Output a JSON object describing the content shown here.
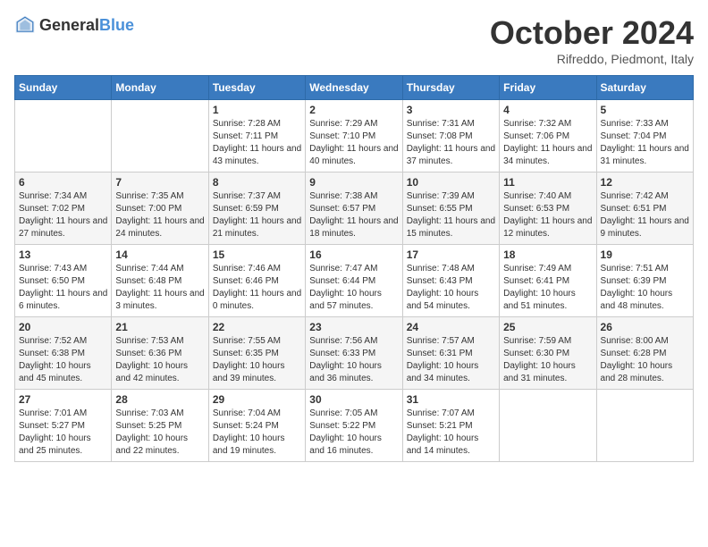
{
  "header": {
    "logo_general": "General",
    "logo_blue": "Blue",
    "title": "October 2024",
    "location": "Rifreddo, Piedmont, Italy"
  },
  "weekdays": [
    "Sunday",
    "Monday",
    "Tuesday",
    "Wednesday",
    "Thursday",
    "Friday",
    "Saturday"
  ],
  "weeks": [
    [
      {
        "day": "",
        "info": ""
      },
      {
        "day": "",
        "info": ""
      },
      {
        "day": "1",
        "info": "Sunrise: 7:28 AM\nSunset: 7:11 PM\nDaylight: 11 hours and 43 minutes."
      },
      {
        "day": "2",
        "info": "Sunrise: 7:29 AM\nSunset: 7:10 PM\nDaylight: 11 hours and 40 minutes."
      },
      {
        "day": "3",
        "info": "Sunrise: 7:31 AM\nSunset: 7:08 PM\nDaylight: 11 hours and 37 minutes."
      },
      {
        "day": "4",
        "info": "Sunrise: 7:32 AM\nSunset: 7:06 PM\nDaylight: 11 hours and 34 minutes."
      },
      {
        "day": "5",
        "info": "Sunrise: 7:33 AM\nSunset: 7:04 PM\nDaylight: 11 hours and 31 minutes."
      }
    ],
    [
      {
        "day": "6",
        "info": "Sunrise: 7:34 AM\nSunset: 7:02 PM\nDaylight: 11 hours and 27 minutes."
      },
      {
        "day": "7",
        "info": "Sunrise: 7:35 AM\nSunset: 7:00 PM\nDaylight: 11 hours and 24 minutes."
      },
      {
        "day": "8",
        "info": "Sunrise: 7:37 AM\nSunset: 6:59 PM\nDaylight: 11 hours and 21 minutes."
      },
      {
        "day": "9",
        "info": "Sunrise: 7:38 AM\nSunset: 6:57 PM\nDaylight: 11 hours and 18 minutes."
      },
      {
        "day": "10",
        "info": "Sunrise: 7:39 AM\nSunset: 6:55 PM\nDaylight: 11 hours and 15 minutes."
      },
      {
        "day": "11",
        "info": "Sunrise: 7:40 AM\nSunset: 6:53 PM\nDaylight: 11 hours and 12 minutes."
      },
      {
        "day": "12",
        "info": "Sunrise: 7:42 AM\nSunset: 6:51 PM\nDaylight: 11 hours and 9 minutes."
      }
    ],
    [
      {
        "day": "13",
        "info": "Sunrise: 7:43 AM\nSunset: 6:50 PM\nDaylight: 11 hours and 6 minutes."
      },
      {
        "day": "14",
        "info": "Sunrise: 7:44 AM\nSunset: 6:48 PM\nDaylight: 11 hours and 3 minutes."
      },
      {
        "day": "15",
        "info": "Sunrise: 7:46 AM\nSunset: 6:46 PM\nDaylight: 11 hours and 0 minutes."
      },
      {
        "day": "16",
        "info": "Sunrise: 7:47 AM\nSunset: 6:44 PM\nDaylight: 10 hours and 57 minutes."
      },
      {
        "day": "17",
        "info": "Sunrise: 7:48 AM\nSunset: 6:43 PM\nDaylight: 10 hours and 54 minutes."
      },
      {
        "day": "18",
        "info": "Sunrise: 7:49 AM\nSunset: 6:41 PM\nDaylight: 10 hours and 51 minutes."
      },
      {
        "day": "19",
        "info": "Sunrise: 7:51 AM\nSunset: 6:39 PM\nDaylight: 10 hours and 48 minutes."
      }
    ],
    [
      {
        "day": "20",
        "info": "Sunrise: 7:52 AM\nSunset: 6:38 PM\nDaylight: 10 hours and 45 minutes."
      },
      {
        "day": "21",
        "info": "Sunrise: 7:53 AM\nSunset: 6:36 PM\nDaylight: 10 hours and 42 minutes."
      },
      {
        "day": "22",
        "info": "Sunrise: 7:55 AM\nSunset: 6:35 PM\nDaylight: 10 hours and 39 minutes."
      },
      {
        "day": "23",
        "info": "Sunrise: 7:56 AM\nSunset: 6:33 PM\nDaylight: 10 hours and 36 minutes."
      },
      {
        "day": "24",
        "info": "Sunrise: 7:57 AM\nSunset: 6:31 PM\nDaylight: 10 hours and 34 minutes."
      },
      {
        "day": "25",
        "info": "Sunrise: 7:59 AM\nSunset: 6:30 PM\nDaylight: 10 hours and 31 minutes."
      },
      {
        "day": "26",
        "info": "Sunrise: 8:00 AM\nSunset: 6:28 PM\nDaylight: 10 hours and 28 minutes."
      }
    ],
    [
      {
        "day": "27",
        "info": "Sunrise: 7:01 AM\nSunset: 5:27 PM\nDaylight: 10 hours and 25 minutes."
      },
      {
        "day": "28",
        "info": "Sunrise: 7:03 AM\nSunset: 5:25 PM\nDaylight: 10 hours and 22 minutes."
      },
      {
        "day": "29",
        "info": "Sunrise: 7:04 AM\nSunset: 5:24 PM\nDaylight: 10 hours and 19 minutes."
      },
      {
        "day": "30",
        "info": "Sunrise: 7:05 AM\nSunset: 5:22 PM\nDaylight: 10 hours and 16 minutes."
      },
      {
        "day": "31",
        "info": "Sunrise: 7:07 AM\nSunset: 5:21 PM\nDaylight: 10 hours and 14 minutes."
      },
      {
        "day": "",
        "info": ""
      },
      {
        "day": "",
        "info": ""
      }
    ]
  ]
}
